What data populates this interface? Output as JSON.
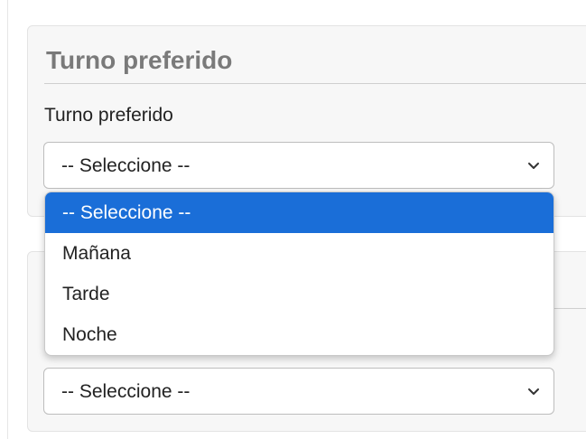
{
  "section": {
    "legend": "Turno preferido",
    "field_label": "Turno preferido"
  },
  "select_primary": {
    "value": "-- Seleccione --",
    "options": [
      "-- Seleccione --",
      "Mañana",
      "Tarde",
      "Noche"
    ],
    "selected_index": 0
  },
  "select_secondary": {
    "value": "-- Seleccione --"
  },
  "colors": {
    "selected_option_bg": "#1a6ed8",
    "legend_text": "#7a7a7a",
    "panel_bg": "#f7f7f7"
  },
  "icons": {
    "select_arrow": "chevron-down-icon"
  }
}
